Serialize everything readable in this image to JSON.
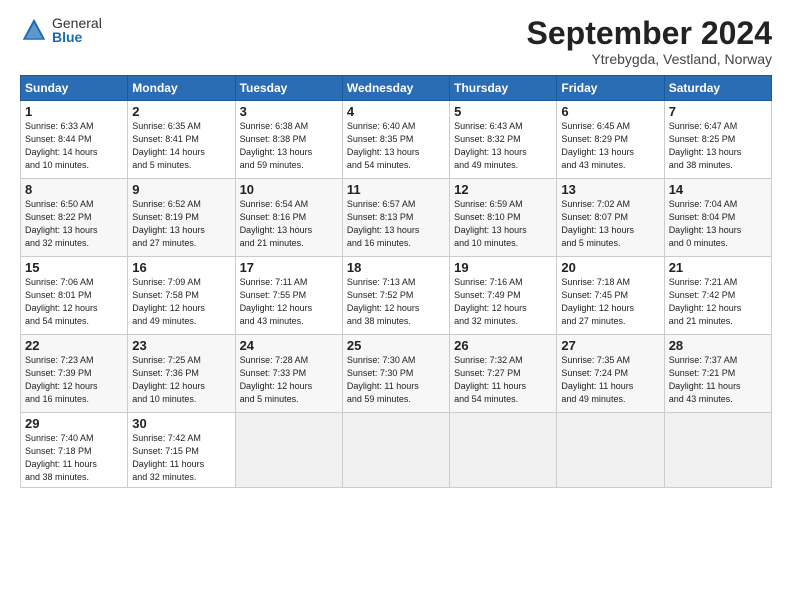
{
  "header": {
    "logo_general": "General",
    "logo_blue": "Blue",
    "month_title": "September 2024",
    "location": "Ytrebygda, Vestland, Norway"
  },
  "columns": [
    "Sunday",
    "Monday",
    "Tuesday",
    "Wednesday",
    "Thursday",
    "Friday",
    "Saturday"
  ],
  "weeks": [
    [
      {
        "day": 1,
        "info": "Sunrise: 6:33 AM\nSunset: 8:44 PM\nDaylight: 14 hours\nand 10 minutes."
      },
      {
        "day": 2,
        "info": "Sunrise: 6:35 AM\nSunset: 8:41 PM\nDaylight: 14 hours\nand 5 minutes."
      },
      {
        "day": 3,
        "info": "Sunrise: 6:38 AM\nSunset: 8:38 PM\nDaylight: 13 hours\nand 59 minutes."
      },
      {
        "day": 4,
        "info": "Sunrise: 6:40 AM\nSunset: 8:35 PM\nDaylight: 13 hours\nand 54 minutes."
      },
      {
        "day": 5,
        "info": "Sunrise: 6:43 AM\nSunset: 8:32 PM\nDaylight: 13 hours\nand 49 minutes."
      },
      {
        "day": 6,
        "info": "Sunrise: 6:45 AM\nSunset: 8:29 PM\nDaylight: 13 hours\nand 43 minutes."
      },
      {
        "day": 7,
        "info": "Sunrise: 6:47 AM\nSunset: 8:25 PM\nDaylight: 13 hours\nand 38 minutes."
      }
    ],
    [
      {
        "day": 8,
        "info": "Sunrise: 6:50 AM\nSunset: 8:22 PM\nDaylight: 13 hours\nand 32 minutes."
      },
      {
        "day": 9,
        "info": "Sunrise: 6:52 AM\nSunset: 8:19 PM\nDaylight: 13 hours\nand 27 minutes."
      },
      {
        "day": 10,
        "info": "Sunrise: 6:54 AM\nSunset: 8:16 PM\nDaylight: 13 hours\nand 21 minutes."
      },
      {
        "day": 11,
        "info": "Sunrise: 6:57 AM\nSunset: 8:13 PM\nDaylight: 13 hours\nand 16 minutes."
      },
      {
        "day": 12,
        "info": "Sunrise: 6:59 AM\nSunset: 8:10 PM\nDaylight: 13 hours\nand 10 minutes."
      },
      {
        "day": 13,
        "info": "Sunrise: 7:02 AM\nSunset: 8:07 PM\nDaylight: 13 hours\nand 5 minutes."
      },
      {
        "day": 14,
        "info": "Sunrise: 7:04 AM\nSunset: 8:04 PM\nDaylight: 13 hours\nand 0 minutes."
      }
    ],
    [
      {
        "day": 15,
        "info": "Sunrise: 7:06 AM\nSunset: 8:01 PM\nDaylight: 12 hours\nand 54 minutes."
      },
      {
        "day": 16,
        "info": "Sunrise: 7:09 AM\nSunset: 7:58 PM\nDaylight: 12 hours\nand 49 minutes."
      },
      {
        "day": 17,
        "info": "Sunrise: 7:11 AM\nSunset: 7:55 PM\nDaylight: 12 hours\nand 43 minutes."
      },
      {
        "day": 18,
        "info": "Sunrise: 7:13 AM\nSunset: 7:52 PM\nDaylight: 12 hours\nand 38 minutes."
      },
      {
        "day": 19,
        "info": "Sunrise: 7:16 AM\nSunset: 7:49 PM\nDaylight: 12 hours\nand 32 minutes."
      },
      {
        "day": 20,
        "info": "Sunrise: 7:18 AM\nSunset: 7:45 PM\nDaylight: 12 hours\nand 27 minutes."
      },
      {
        "day": 21,
        "info": "Sunrise: 7:21 AM\nSunset: 7:42 PM\nDaylight: 12 hours\nand 21 minutes."
      }
    ],
    [
      {
        "day": 22,
        "info": "Sunrise: 7:23 AM\nSunset: 7:39 PM\nDaylight: 12 hours\nand 16 minutes."
      },
      {
        "day": 23,
        "info": "Sunrise: 7:25 AM\nSunset: 7:36 PM\nDaylight: 12 hours\nand 10 minutes."
      },
      {
        "day": 24,
        "info": "Sunrise: 7:28 AM\nSunset: 7:33 PM\nDaylight: 12 hours\nand 5 minutes."
      },
      {
        "day": 25,
        "info": "Sunrise: 7:30 AM\nSunset: 7:30 PM\nDaylight: 11 hours\nand 59 minutes."
      },
      {
        "day": 26,
        "info": "Sunrise: 7:32 AM\nSunset: 7:27 PM\nDaylight: 11 hours\nand 54 minutes."
      },
      {
        "day": 27,
        "info": "Sunrise: 7:35 AM\nSunset: 7:24 PM\nDaylight: 11 hours\nand 49 minutes."
      },
      {
        "day": 28,
        "info": "Sunrise: 7:37 AM\nSunset: 7:21 PM\nDaylight: 11 hours\nand 43 minutes."
      }
    ],
    [
      {
        "day": 29,
        "info": "Sunrise: 7:40 AM\nSunset: 7:18 PM\nDaylight: 11 hours\nand 38 minutes."
      },
      {
        "day": 30,
        "info": "Sunrise: 7:42 AM\nSunset: 7:15 PM\nDaylight: 11 hours\nand 32 minutes."
      },
      null,
      null,
      null,
      null,
      null
    ]
  ]
}
